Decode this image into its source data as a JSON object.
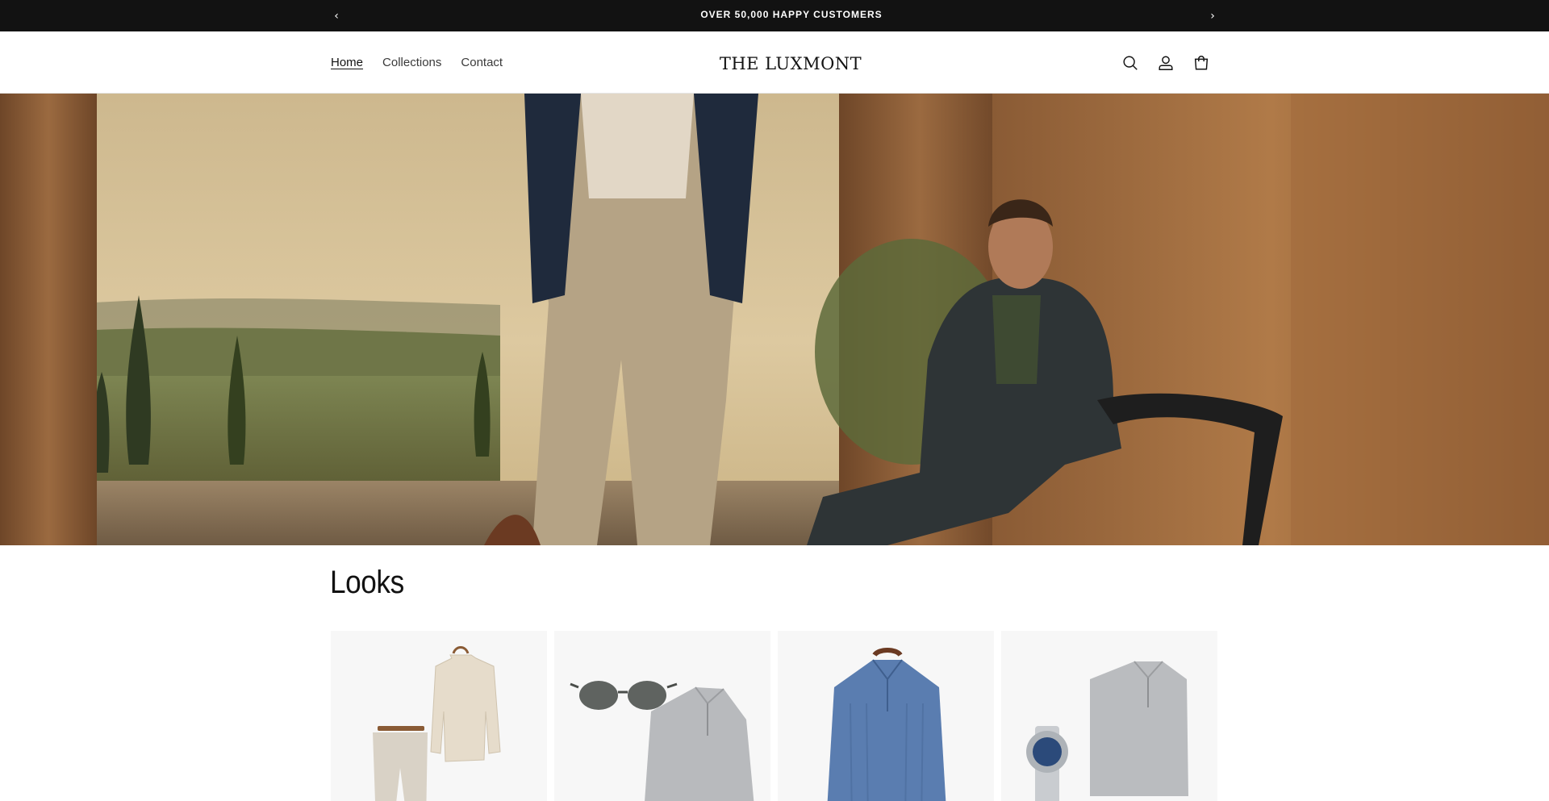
{
  "announcement": {
    "message": "OVER 50,000 HAPPY CUSTOMERS",
    "prev_icon": "chevron-left-icon",
    "next_icon": "chevron-right-icon"
  },
  "header": {
    "nav": [
      {
        "label": "Home",
        "active": true
      },
      {
        "label": "Collections",
        "active": false
      },
      {
        "label": "Contact",
        "active": false
      }
    ],
    "logo": "THE LUXMONT",
    "icons": [
      "search-icon",
      "account-icon",
      "cart-icon"
    ]
  },
  "hero": {
    "image": "two men in tailored menswear on a terrace overlooking rolling hills"
  },
  "looks": {
    "title": "Looks",
    "cards": [
      {
        "image": "linen shirt on hanger with beige trousers"
      },
      {
        "image": "sunglasses with grey quarter-zip sweater"
      },
      {
        "image": "blue cable-knit quarter-zip sweater"
      },
      {
        "image": "silver watch with grey quarter-zip sweater"
      }
    ]
  },
  "colors": {
    "announcement_bg": "#121212",
    "text": "#121212",
    "card_bg": "#f7f7f7"
  }
}
